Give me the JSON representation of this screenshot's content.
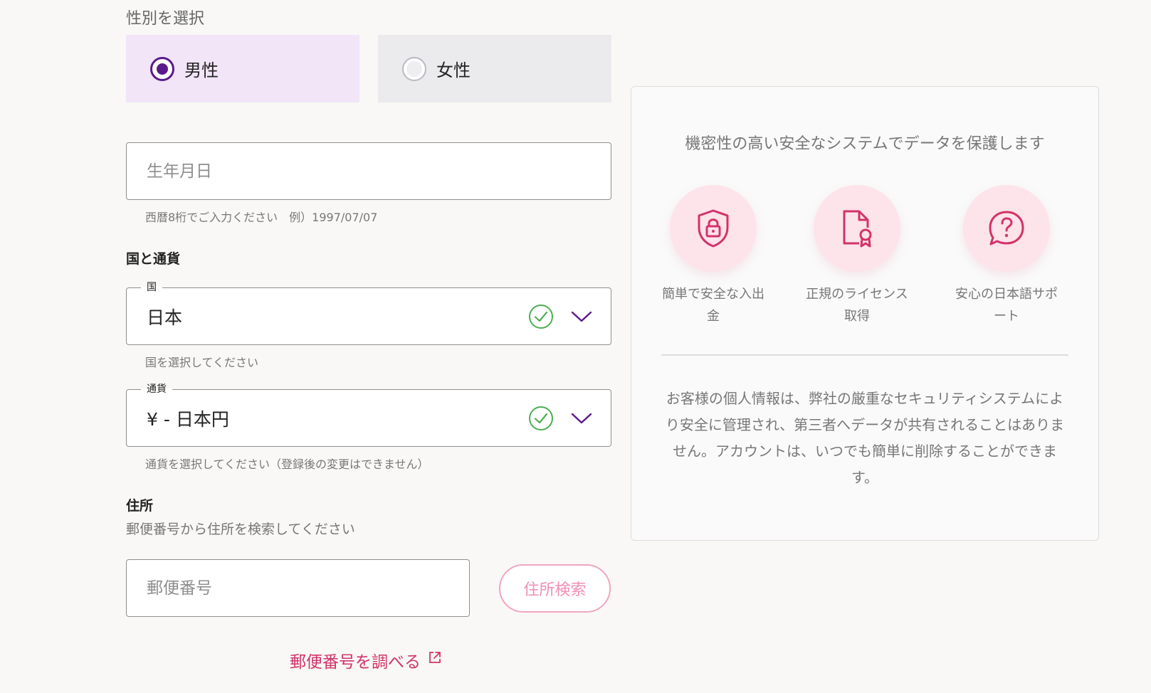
{
  "gender": {
    "label": "性別を選択",
    "options": [
      {
        "label": "男性",
        "selected": true
      },
      {
        "label": "女性",
        "selected": false
      }
    ]
  },
  "birthdate": {
    "placeholder": "生年月日",
    "value": "",
    "hint": "西暦8桁でご入力ください　例）1997/07/07"
  },
  "country_currency": {
    "title": "国と通貨",
    "country": {
      "label": "国",
      "value": "日本",
      "hint": "国を選択してください"
    },
    "currency": {
      "label": "通貨",
      "value": "¥ - 日本円",
      "hint": "通貨を選択してください（登録後の変更はできません）"
    }
  },
  "address": {
    "title": "住所",
    "subtitle": "郵便番号から住所を検索してください",
    "postal_placeholder": "郵便番号",
    "search_button": "住所検索",
    "lookup_link": "郵便番号を調べる"
  },
  "security_panel": {
    "title": "機密性の高い安全なシステムでデータを保護します",
    "features": [
      {
        "icon": "shield-lock-icon",
        "label": "簡単で安全な入出金"
      },
      {
        "icon": "license-certificate-icon",
        "label": "正規のライセンス取得"
      },
      {
        "icon": "support-chat-icon",
        "label": "安心の日本語サポート"
      }
    ],
    "body": "お客様の個人情報は、弊社の厳重なセキュリティシステムにより安全に管理され、第三者へデータが共有されることはありません。アカウントは、いつでも簡単に削除することができます。"
  },
  "colors": {
    "accent_purple": "#5a1a8c",
    "accent_pink": "#d2336b",
    "check_green": "#4caf50",
    "icon_pink_bg": "#fde3ea"
  }
}
